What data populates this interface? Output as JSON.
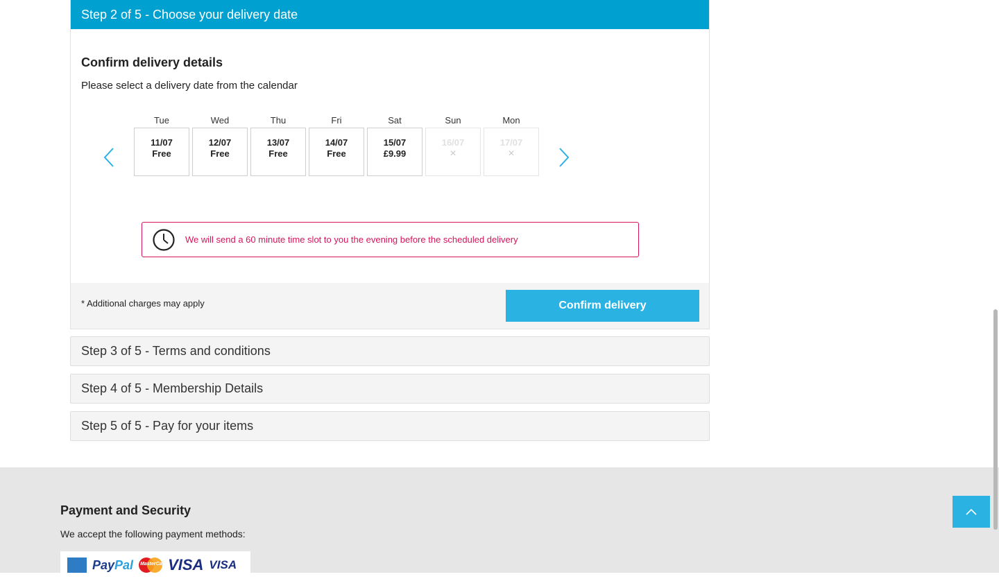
{
  "step2": {
    "header": "Step 2 of 5 - Choose your delivery date",
    "title": "Confirm delivery details",
    "subtitle": "Please select a delivery date from the calendar",
    "days": [
      {
        "name": "Tue",
        "date": "11/07",
        "price": "Free",
        "available": true
      },
      {
        "name": "Wed",
        "date": "12/07",
        "price": "Free",
        "available": true
      },
      {
        "name": "Thu",
        "date": "13/07",
        "price": "Free",
        "available": true
      },
      {
        "name": "Fri",
        "date": "14/07",
        "price": "Free",
        "available": true
      },
      {
        "name": "Sat",
        "date": "15/07",
        "price": "£9.99",
        "available": true
      },
      {
        "name": "Sun",
        "date": "16/07",
        "price": "×",
        "available": false
      },
      {
        "name": "Mon",
        "date": "17/07",
        "price": "×",
        "available": false
      }
    ],
    "notice": "We will send a 60 minute time slot to you the evening before the scheduled delivery",
    "charges": "* Additional charges may apply",
    "confirm_button": "Confirm delivery"
  },
  "steps": {
    "step3": "Step 3 of 5 - Terms and conditions",
    "step4": "Step 4 of 5 - Membership Details",
    "step5": "Step 5 of 5 - Pay for your items"
  },
  "footer": {
    "title": "Payment and Security",
    "subtitle": "We accept the following payment methods:",
    "logos": [
      "amex-logo",
      "paypal-logo",
      "mastercard-logo",
      "visa-logo",
      "visa-debit-logo"
    ]
  },
  "colors": {
    "header_blue": "#00a0d0",
    "button_blue": "#29b2e2",
    "notice_pink": "#d4145a"
  }
}
